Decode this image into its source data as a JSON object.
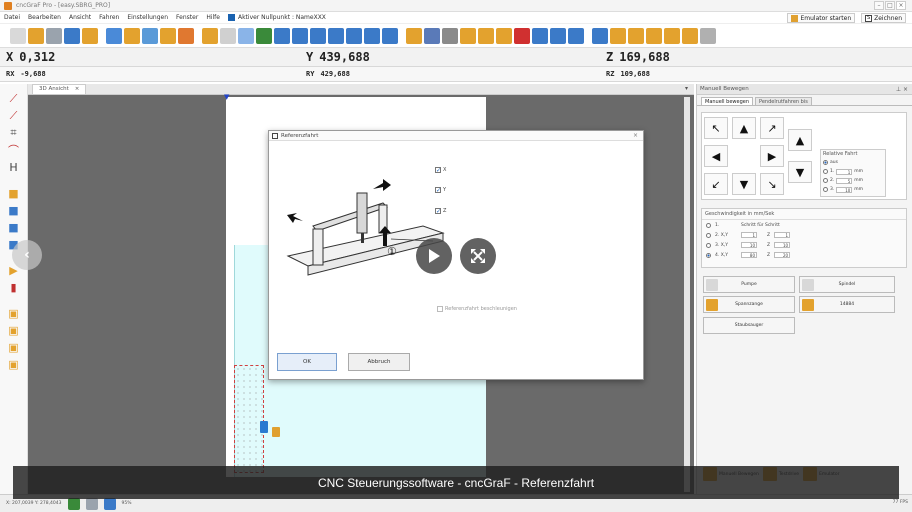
{
  "window": {
    "title": "cncGraF Pro - [easy.SBRG_PRO]"
  },
  "menu": {
    "items": [
      "Datei",
      "Bearbeiten",
      "Ansicht",
      "Fahren",
      "Einstellungen",
      "Fenster",
      "Hilfe"
    ],
    "active_zero_point": "Aktiver Nullpunkt : NameXXX",
    "emulator_start": "Emulator starten",
    "drawing_button": "Zeichnen"
  },
  "coords": {
    "x_label": "X",
    "x_value": "0,312",
    "y_label": "Y",
    "y_value": "439,688",
    "z_label": "Z",
    "z_value": "169,688",
    "rx_label": "RX",
    "rx_value": "-9,688",
    "ry_label": "RY",
    "ry_value": "429,688",
    "rz_label": "RZ",
    "rz_value": "109,688"
  },
  "document_tab": {
    "label": "3D Ansicht",
    "close": "×",
    "menu_arrow": "▾"
  },
  "dialog": {
    "title": "Referenzfahrt",
    "close": "×",
    "checkbox_x": "X",
    "checkbox_y": "Y",
    "checkbox_z": "Z",
    "check_mark": "✓",
    "callout_number": "①",
    "reference_checkbox": "Referenzfahrt beschleunigen",
    "ok_label": "OK",
    "cancel_label": "Abbruch"
  },
  "right_panel": {
    "header": "Manuell Bewegen",
    "pin": "⊥ ×",
    "tabs": [
      "Manuell bewegen",
      "Pendelrutfahren bis"
    ],
    "relative": {
      "title": "Relative Fahrt",
      "off": "aus",
      "opt1": "1.",
      "opt1_value": "1",
      "opt2": "2.",
      "opt2_value": "5",
      "opt3": "3.",
      "opt3_value": "10",
      "unit": "mm"
    },
    "speed": {
      "title": "Geschwindigkeit in mm/Sek",
      "row1": "1.",
      "row1_label": "Schritt für Schritt",
      "row2": "2. X,Y",
      "row2_v1": "1",
      "row2_z": "Z",
      "row2_v2": "1",
      "row3": "3. X,Y",
      "row3_v1": "10",
      "row3_z": "Z",
      "row3_v2": "10",
      "row4": "4. X,Y",
      "row4_v1": "80",
      "row4_z": "Z",
      "row4_v2": "20"
    },
    "buttons": {
      "pump": "Pumpe",
      "spindle": "Spindel",
      "clamp": "Spannzange",
      "counter": "14884",
      "vacuum": "Staubsauger"
    },
    "bottom": {
      "manual": "Manuell Bewegen",
      "test": "Testdrive",
      "emulator": "Emulator"
    }
  },
  "status": {
    "coords": "X: 207,0039  Y: 278,4043",
    "zoom": "95%",
    "fps": "77 FPS"
  },
  "nav": {
    "prev": "‹",
    "next": "›"
  },
  "caption": "CNC Steuerungssoftware - cncGraF - Referenzfahrt"
}
